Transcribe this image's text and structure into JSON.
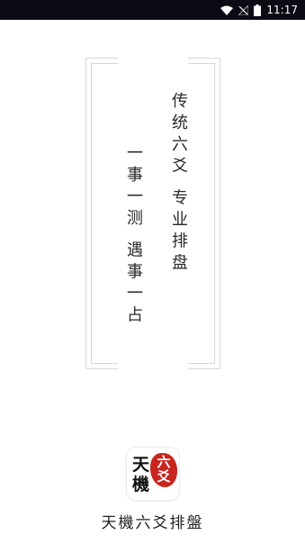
{
  "status_bar": {
    "time": "11:17",
    "icons": [
      "wifi-icon",
      "signal-off-icon",
      "battery-icon"
    ]
  },
  "slogan": {
    "line1": "传统六爻 专业排盘",
    "line2": "一事一测 遇事一占"
  },
  "app_icon": {
    "char1": "天",
    "char2": "機",
    "seal_char1": "六",
    "seal_char2": "爻",
    "seal_color": "#c8251f"
  },
  "app_name": "天機六爻排盤"
}
